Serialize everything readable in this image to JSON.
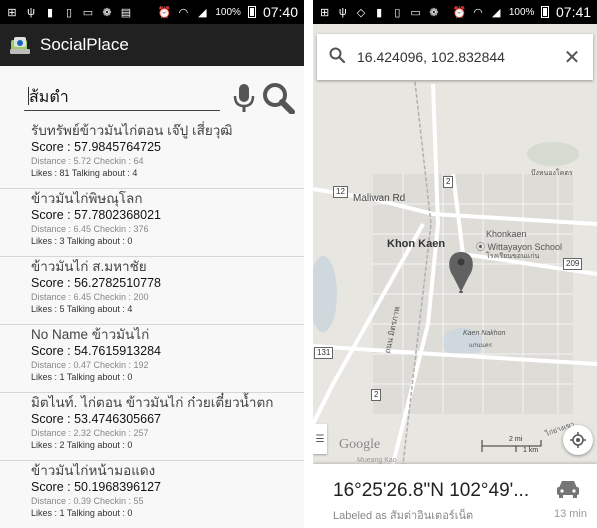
{
  "left_phone": {
    "status": {
      "battery": "100%",
      "time": "07:40"
    },
    "app_title": "SocialPlace",
    "search": {
      "value": "ส้มตำ"
    },
    "results": [
      {
        "name": "รับทรัพย์ข้าวมันไก่ตอน เจ๊ปู เสี่ยวุฒิ",
        "score": "Score : 57.9845764725",
        "dist": "Distance : 5.72  Checkin : 64",
        "likes": "Likes : 81 Talking about : 4"
      },
      {
        "name": "ข้าวมันไก่พิษณุโลก",
        "score": "Score : 57.7802368021",
        "dist": "Distance : 6.45  Checkin : 376",
        "likes": "Likes : 3 Talking about : 0"
      },
      {
        "name": "ข้าวมันไก่ ส.มหาชัย",
        "score": "Score : 56.2782510778",
        "dist": "Distance : 6.45  Checkin : 200",
        "likes": "Likes : 5 Talking about : 4"
      },
      {
        "name": "No Name ข้าวมันไก่",
        "score": "Score : 54.7615913284",
        "dist": "Distance : 0.47  Checkin : 192",
        "likes": "Likes : 1 Talking about : 0"
      },
      {
        "name": "มิตไนท์. ไก่ตอน ข้าวมันไก่ ก๋วยเตี๋ยวน้ำตก",
        "score": "Score : 53.4746305667",
        "dist": "Distance : 2.32  Checkin : 257",
        "likes": "Likes : 2 Talking about : 0"
      },
      {
        "name": "ข้าวมันไก่หน้ามอแดง",
        "score": "Score : 50.1968396127",
        "dist": "Distance : 0.39  Checkin : 55",
        "likes": "Likes : 1 Talking about : 0"
      }
    ]
  },
  "right_phone": {
    "status": {
      "battery": "100%",
      "time": "07:41"
    },
    "search_query": "16.424096, 102.832844",
    "map_labels": {
      "maliwan_rd": "Maliwan Rd",
      "khon_kaen": "Khon Kaen",
      "khonkaen_school": "Khonkaen",
      "wittayayon": "Wittayayon School",
      "school_thai": "โรงเรียนขอนแก่น",
      "kaen_nakhon": "Kaen Nakhon",
      "kaen_nakhon_thai": "แก่นนคร",
      "mittraphap": "ถนน มิตรภาพ",
      "top_right": "บึงหนองโคตร",
      "muang_kao": "Mueang Kao",
      "bottom_right_thai": "ไก่ย่างเขา"
    },
    "road_numbers": {
      "r12": "12",
      "r2_top": "2",
      "r209": "209",
      "r131": "131",
      "r2_bottom": "2"
    },
    "map_brand": "Google",
    "scale": {
      "left": "2 mi",
      "right": "1 km"
    },
    "place": {
      "coordinate": "16°25'26.8\"N 102°49'...",
      "label": "Labeled as สัมต่าอินเตอร์เน็ต",
      "eta": "13 min"
    },
    "colors": {
      "pin": "#616161",
      "map_bg": "#e5e3df",
      "road": "#ffffff"
    }
  }
}
